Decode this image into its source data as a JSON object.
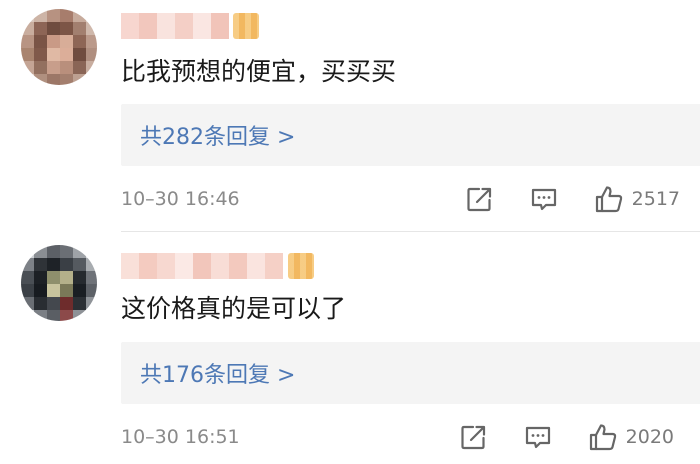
{
  "comments": [
    {
      "text": "比我预想的便宜，买买买",
      "replies_label": "共282条回复 >",
      "timestamp": "10–30 16:46",
      "like_count": "2517"
    },
    {
      "text": "这价格真的是可以了",
      "replies_label": "共176条回复 >",
      "timestamp": "10–30 16:51",
      "like_count": "2020"
    }
  ],
  "icons": {
    "share": "share-icon",
    "comment": "comment-icon",
    "like": "thumbs-up-icon"
  },
  "colors": {
    "link": "#4d78b5",
    "reply_bg": "#f4f4f4",
    "meta": "#8a8a8a",
    "vip_badge": "#f1b04e"
  }
}
